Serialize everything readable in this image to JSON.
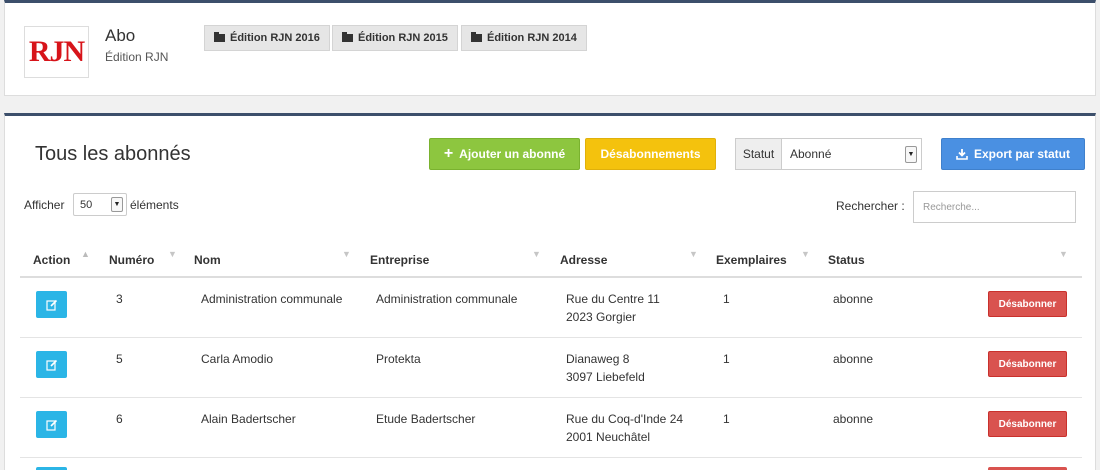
{
  "header": {
    "logo_text": "RJN",
    "title": "Abo",
    "subtitle": "Édition RJN",
    "editions": [
      "Édition RJN 2016",
      "Édition RJN 2015",
      "Édition RJN 2014"
    ]
  },
  "main": {
    "title": "Tous les abonnés",
    "add_label": "Ajouter un abonné",
    "unsubscriptions_label": "Désabonnements",
    "status_label": "Statut",
    "status_value": "Abonné",
    "export_label": "Export par statut",
    "show_label": "Afficher",
    "page_length": "50",
    "entries_label": "éléments",
    "search_label": "Rechercher :",
    "search_placeholder": "Recherche..."
  },
  "table": {
    "columns": [
      "Action",
      "Numéro",
      "Nom",
      "Entreprise",
      "Adresse",
      "Exemplaires",
      "Status"
    ],
    "unsubscribe_label": "Désabonner",
    "rows": [
      {
        "numero": "3",
        "nom": "Administration communale",
        "entreprise": "Administration communale",
        "adresse1": "Rue du Centre 11",
        "adresse2": "2023 Gorgier",
        "exemplaires": "1",
        "status": "abonne"
      },
      {
        "numero": "5",
        "nom": "Carla Amodio",
        "entreprise": "Protekta",
        "adresse1": "Dianaweg 8",
        "adresse2": "3097 Liebefeld",
        "exemplaires": "1",
        "status": "abonne"
      },
      {
        "numero": "6",
        "nom": "Alain Badertscher",
        "entreprise": "Etude Badertscher",
        "adresse1": "Rue du Coq-d'Inde 24",
        "adresse2": "2001 Neuchâtel",
        "exemplaires": "1",
        "status": "abonne"
      }
    ]
  },
  "colors": {
    "brand_red": "#d7141a",
    "add_green": "#8dc63f",
    "unsubs_yellow": "#f4c20d",
    "export_blue": "#4a90e2",
    "edit_cyan": "#2bb5e6",
    "danger_red": "#d9534f",
    "panel_border": "#3c4f6b"
  }
}
